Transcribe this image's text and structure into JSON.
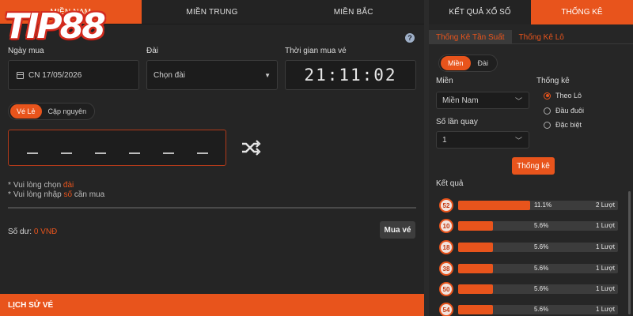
{
  "logo": {
    "text": "TIP88"
  },
  "top_tabs": [
    {
      "label": "MIỀN NAM"
    },
    {
      "label": "MIỀN TRUNG"
    },
    {
      "label": "MIỀN BẮC"
    }
  ],
  "help_icon": "?",
  "form": {
    "date_label": "Ngày mua",
    "date_value": "CN 17/05/2026",
    "dai_label": "Đài",
    "dai_value": "Chọn đài",
    "time_label": "Thời gian mua vé",
    "time_value": "21:11:02"
  },
  "ticket_toggle": {
    "options": [
      {
        "label": "Vé Lẻ"
      },
      {
        "label": "Cặp nguyên"
      }
    ],
    "selected": 0
  },
  "number_slots": [
    "_",
    "_",
    "_",
    "_",
    "_",
    "_"
  ],
  "hints": {
    "line1_prefix": "Vui lòng chọn ",
    "line1_highlight": "đài",
    "line2_prefix": "Vui lòng nhập ",
    "line2_highlight": "số",
    "line2_suffix": " cần mua"
  },
  "balance": {
    "label": "Số dư: ",
    "amount": "0 VNĐ"
  },
  "buy_button": "Mua vé",
  "history_title": "LỊCH SỬ VÉ",
  "right": {
    "tabs": [
      {
        "label": "KẾT QUẢ XỔ SỐ"
      },
      {
        "label": "THỐNG KÊ"
      }
    ],
    "active_tab": 1,
    "sub_tabs": [
      {
        "label": "Thống Kê Tần Suất"
      },
      {
        "label": "Thống Kê Lô"
      }
    ],
    "active_sub_tab": 0,
    "pills": [
      {
        "label": "Miền"
      },
      {
        "label": "Đài"
      }
    ],
    "active_pill": 0,
    "mien_label": "Miền",
    "mien_value": "Miền Nam",
    "quay_label": "Số lần quay",
    "quay_value": "1",
    "thongke_label": "Thống kê",
    "radio_options": [
      {
        "label": "Theo Lô"
      },
      {
        "label": "Đầu đuôi"
      },
      {
        "label": "Đặc biệt"
      }
    ],
    "radio_selected": 0,
    "stat_button": "Thống kê",
    "results_title": "Kết quả",
    "results": [
      {
        "number": "52",
        "percent": "11.1%",
        "fraction": 0.45,
        "count": "2 Lượt"
      },
      {
        "number": "10",
        "percent": "5.6%",
        "fraction": 0.22,
        "count": "1 Lượt"
      },
      {
        "number": "18",
        "percent": "5.6%",
        "fraction": 0.22,
        "count": "1 Lượt"
      },
      {
        "number": "38",
        "percent": "5.6%",
        "fraction": 0.22,
        "count": "1 Lượt"
      },
      {
        "number": "50",
        "percent": "5.6%",
        "fraction": 0.22,
        "count": "1 Lượt"
      },
      {
        "number": "54",
        "percent": "5.6%",
        "fraction": 0.22,
        "count": "1 Lượt"
      }
    ]
  },
  "colors": {
    "accent": "#e8541c",
    "background": "#252525"
  }
}
